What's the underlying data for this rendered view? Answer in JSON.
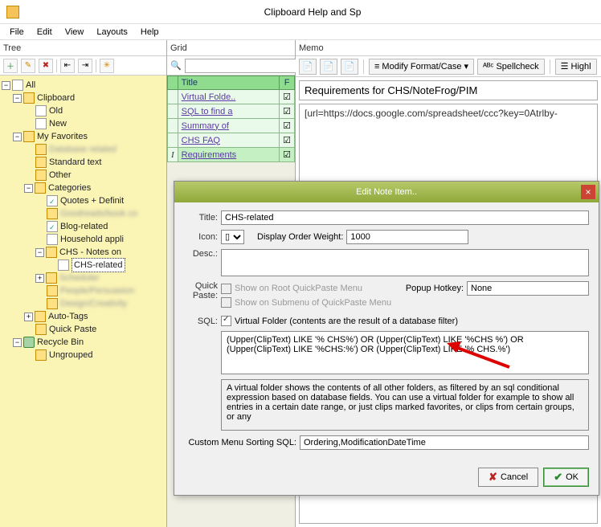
{
  "window": {
    "title": "Clipboard Help and Sp"
  },
  "menus": [
    "File",
    "Edit",
    "View",
    "Layouts",
    "Help"
  ],
  "panels": {
    "tree": "Tree",
    "grid": "Grid",
    "memo": "Memo"
  },
  "tree": {
    "all": "All",
    "clipboard": "Clipboard",
    "old": "Old",
    "new": "New",
    "myfav": "My Favorites",
    "std": "Standard text",
    "other": "Other",
    "categories": "Categories",
    "quotes": "Quotes + Definit",
    "blog": "Blog-related",
    "household": "Household appli",
    "chsnotes": "CHS - Notes on",
    "chsrel": "CHS-related",
    "autotags": "Auto-Tags",
    "quickpaste": "Quick Paste",
    "recycle": "Recycle Bin",
    "ungrouped": "Ungrouped",
    "blur1": "Database related",
    "blur2": "Goodreads/book co",
    "blur3": "Scheduler",
    "blur4": "People/Persuasion",
    "blur5": "Design/Creativity"
  },
  "grid": {
    "col_title": "Title",
    "col_f": "F",
    "rows": [
      {
        "title": "Virtual Folde..",
        "f": true
      },
      {
        "title": "SQL to find a",
        "f": true
      },
      {
        "title": "Summary of",
        "f": true
      },
      {
        "title": "CHS FAQ",
        "f": true
      },
      {
        "title": "Requirements",
        "f": true
      }
    ]
  },
  "memo": {
    "modify_label": "Modify Format/Case",
    "spell_label": "Spellcheck",
    "highl_label": "Highl",
    "title_text": "Requirements for CHS/NoteFrog/PIM",
    "body_text": "[url=https://docs.google.com/spreadsheet/ccc?key=0Atrlby-"
  },
  "dialog": {
    "title": "Edit Note Item..",
    "title_lab": "Title:",
    "title_val": "CHS-related",
    "icon_lab": "Icon:",
    "icon_val": "▯",
    "dow_lab": "Display Order Weight:",
    "dow_val": "1000",
    "desc_lab": "Desc.:",
    "desc_val": "",
    "qp_lab": "Quick Paste:",
    "qp_root": "Show on Root QuickPaste Menu",
    "qp_sub": "Show on Submenu of QuickPaste Menu",
    "popup_lab": "Popup Hotkey:",
    "popup_val": "None",
    "sql_lab": "SQL:",
    "vf_lab": "Virtual Folder (contents are the result of a database filter)",
    "sql_text": "(Upper(ClipText) LIKE '% CHS%') OR (Upper(ClipText) LIKE '%CHS %') OR (Upper(ClipText) LIKE '%CHS:%') OR (Upper(ClipText) LIKE '% CHS.%')",
    "help_text": "A virtual folder shows the contents of all other folders, as filtered by an sql conditional expression based on database fields.  You can use a virtual folder for example to show all entries in a certain date range, or just clips marked favorites, or clips from certain groups, or any",
    "cms_lab": "Custom Menu Sorting SQL:",
    "cms_val": "Ordering,ModificationDateTime",
    "cancel": "Cancel",
    "ok": "OK"
  }
}
